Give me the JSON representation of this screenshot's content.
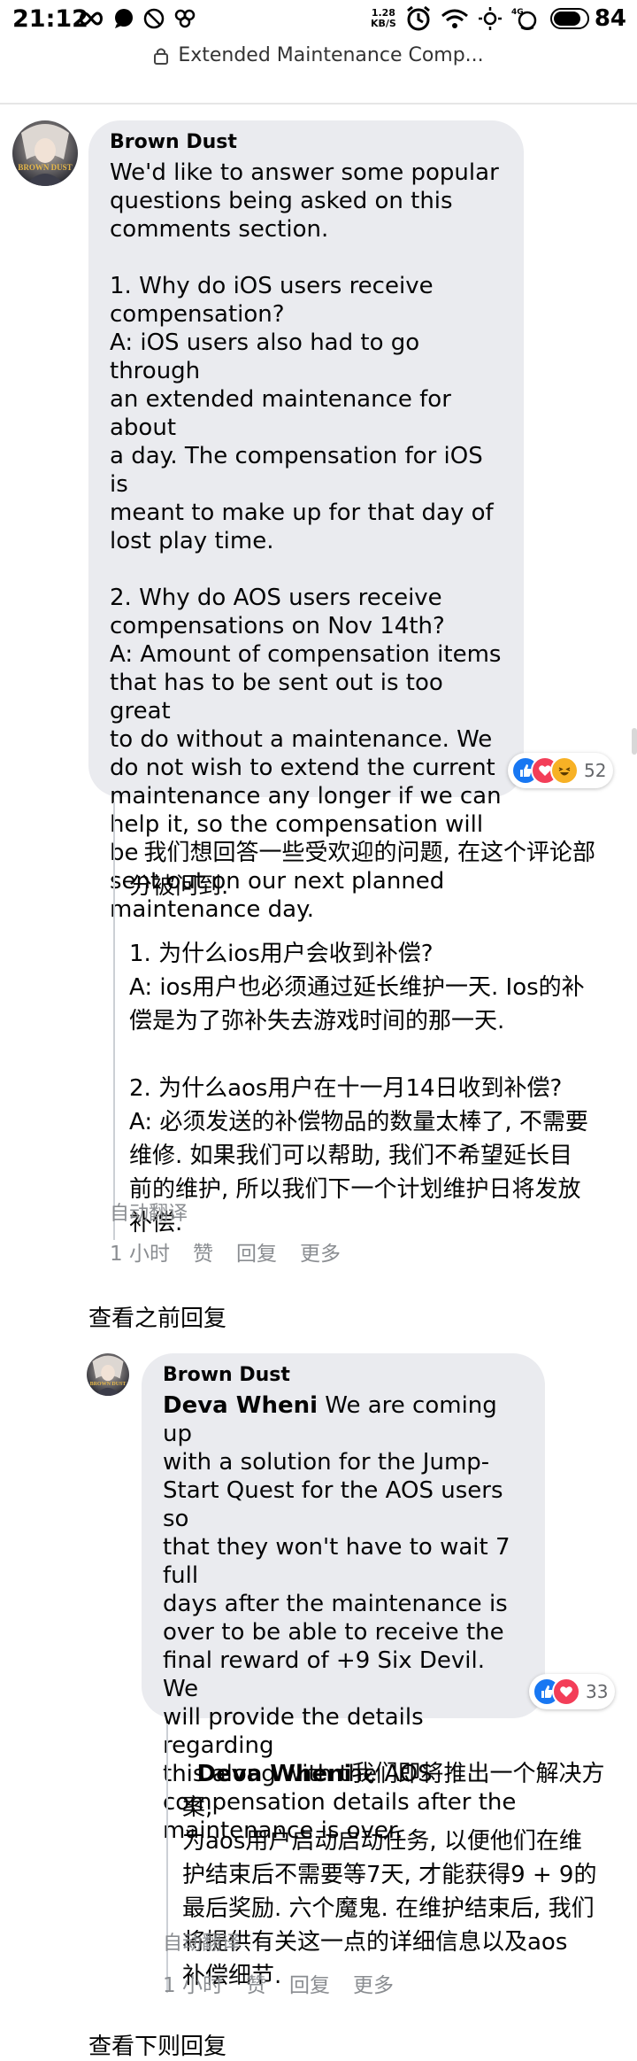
{
  "status_bar": {
    "time": "21:12",
    "speed_value": "1.28",
    "speed_unit": "KB/S",
    "battery_level": "84",
    "battery_fraction": 0.84,
    "icons": [
      "loop-icon",
      "chat-bubble-icon",
      "do-not-disturb-icon",
      "bonsai-icon",
      "alarm-icon",
      "wifi-icon",
      "sun-icon",
      "signal-icon"
    ]
  },
  "url_bar": {
    "lock_icon": "lock-icon",
    "title": "Extended Maintenance Comp..."
  },
  "comments": [
    {
      "author": "Brown Dust",
      "avatar_label": "BROWN DUST",
      "text": "We'd like to answer some popular\nquestions being asked on this\ncomments section.\n\n1. Why do iOS users receive\ncompensation?\nA: iOS users also had to go through\nan extended maintenance for about\na day. The compensation for iOS is\nmeant to make up for that day of\nlost play time.\n\n2. Why do AOS users receive\ncompensations on Nov 14th?\nA: Amount of compensation items\nthat has to be sent out is too great\nto do without a maintenance. We\ndo not wish to extend the current\nmaintenance any longer if we can\nhelp it, so the compensation will be\nsent out on our next planned\nmaintenance day.",
      "reactions": [
        "like",
        "love",
        "haha"
      ],
      "reaction_count": "52",
      "translation": "我们想回答一些受欢迎的问题, 在这个评论部\n分被问到.\n\n1. 为什么ios用户会收到补偿?\nA: ios用户也必须通过延长维护一天. Ios的补\n偿是为了弥补失去游戏时间的那一天.\n\n2. 为什么aos用户在十一月14日收到补偿?\nA: 必须发送的补偿物品的数量太棒了, 不需要\n维修. 如果我们可以帮助, 我们不希望延长目\n前的维护, 所以我们下一个计划维护日将发放\n补偿.",
      "auto_translate": "自动翻译",
      "time": "1 小时",
      "like": "赞",
      "reply": "回复",
      "more": "更多"
    },
    {
      "author": "Brown Dust",
      "avatar_label": "BROWN DUST",
      "mention": "Deva Wheni",
      "text": " We are coming up\nwith a solution for the Jump-\nStart Quest for the AOS users so\nthat they won't have to wait 7 full\ndays after the maintenance is\nover to be able to receive the\nfinal reward of +9 Six Devil. We\nwill provide the details regarding\nthis along with the AOS\ncompensation details after the\nmaintenance is over.",
      "reactions": [
        "like",
        "love"
      ],
      "reaction_count": "33",
      "translation_mention": "Deva Wheni",
      "translation": "我们即将推出一个解决方案,\n为aos用户启动启动任务, 以便他们在维\n护结束后不需要等7天, 才能获得9 + 9的\n最后奖励. 六个魔鬼. 在维护结束后, 我们\n将提供有关这一点的详细信息以及aos\n补偿细节.",
      "auto_translate": "自动翻译",
      "time": "1 小时",
      "like": "赞",
      "reply": "回复",
      "more": "更多"
    }
  ],
  "view_previous": "查看之前回复",
  "view_next": "查看下则回复",
  "colors": {
    "bubble": "#eaebef",
    "like": "#1877f2",
    "love": "#f33e58",
    "haha": "#f7b125",
    "meta_text": "#8a8d91"
  }
}
